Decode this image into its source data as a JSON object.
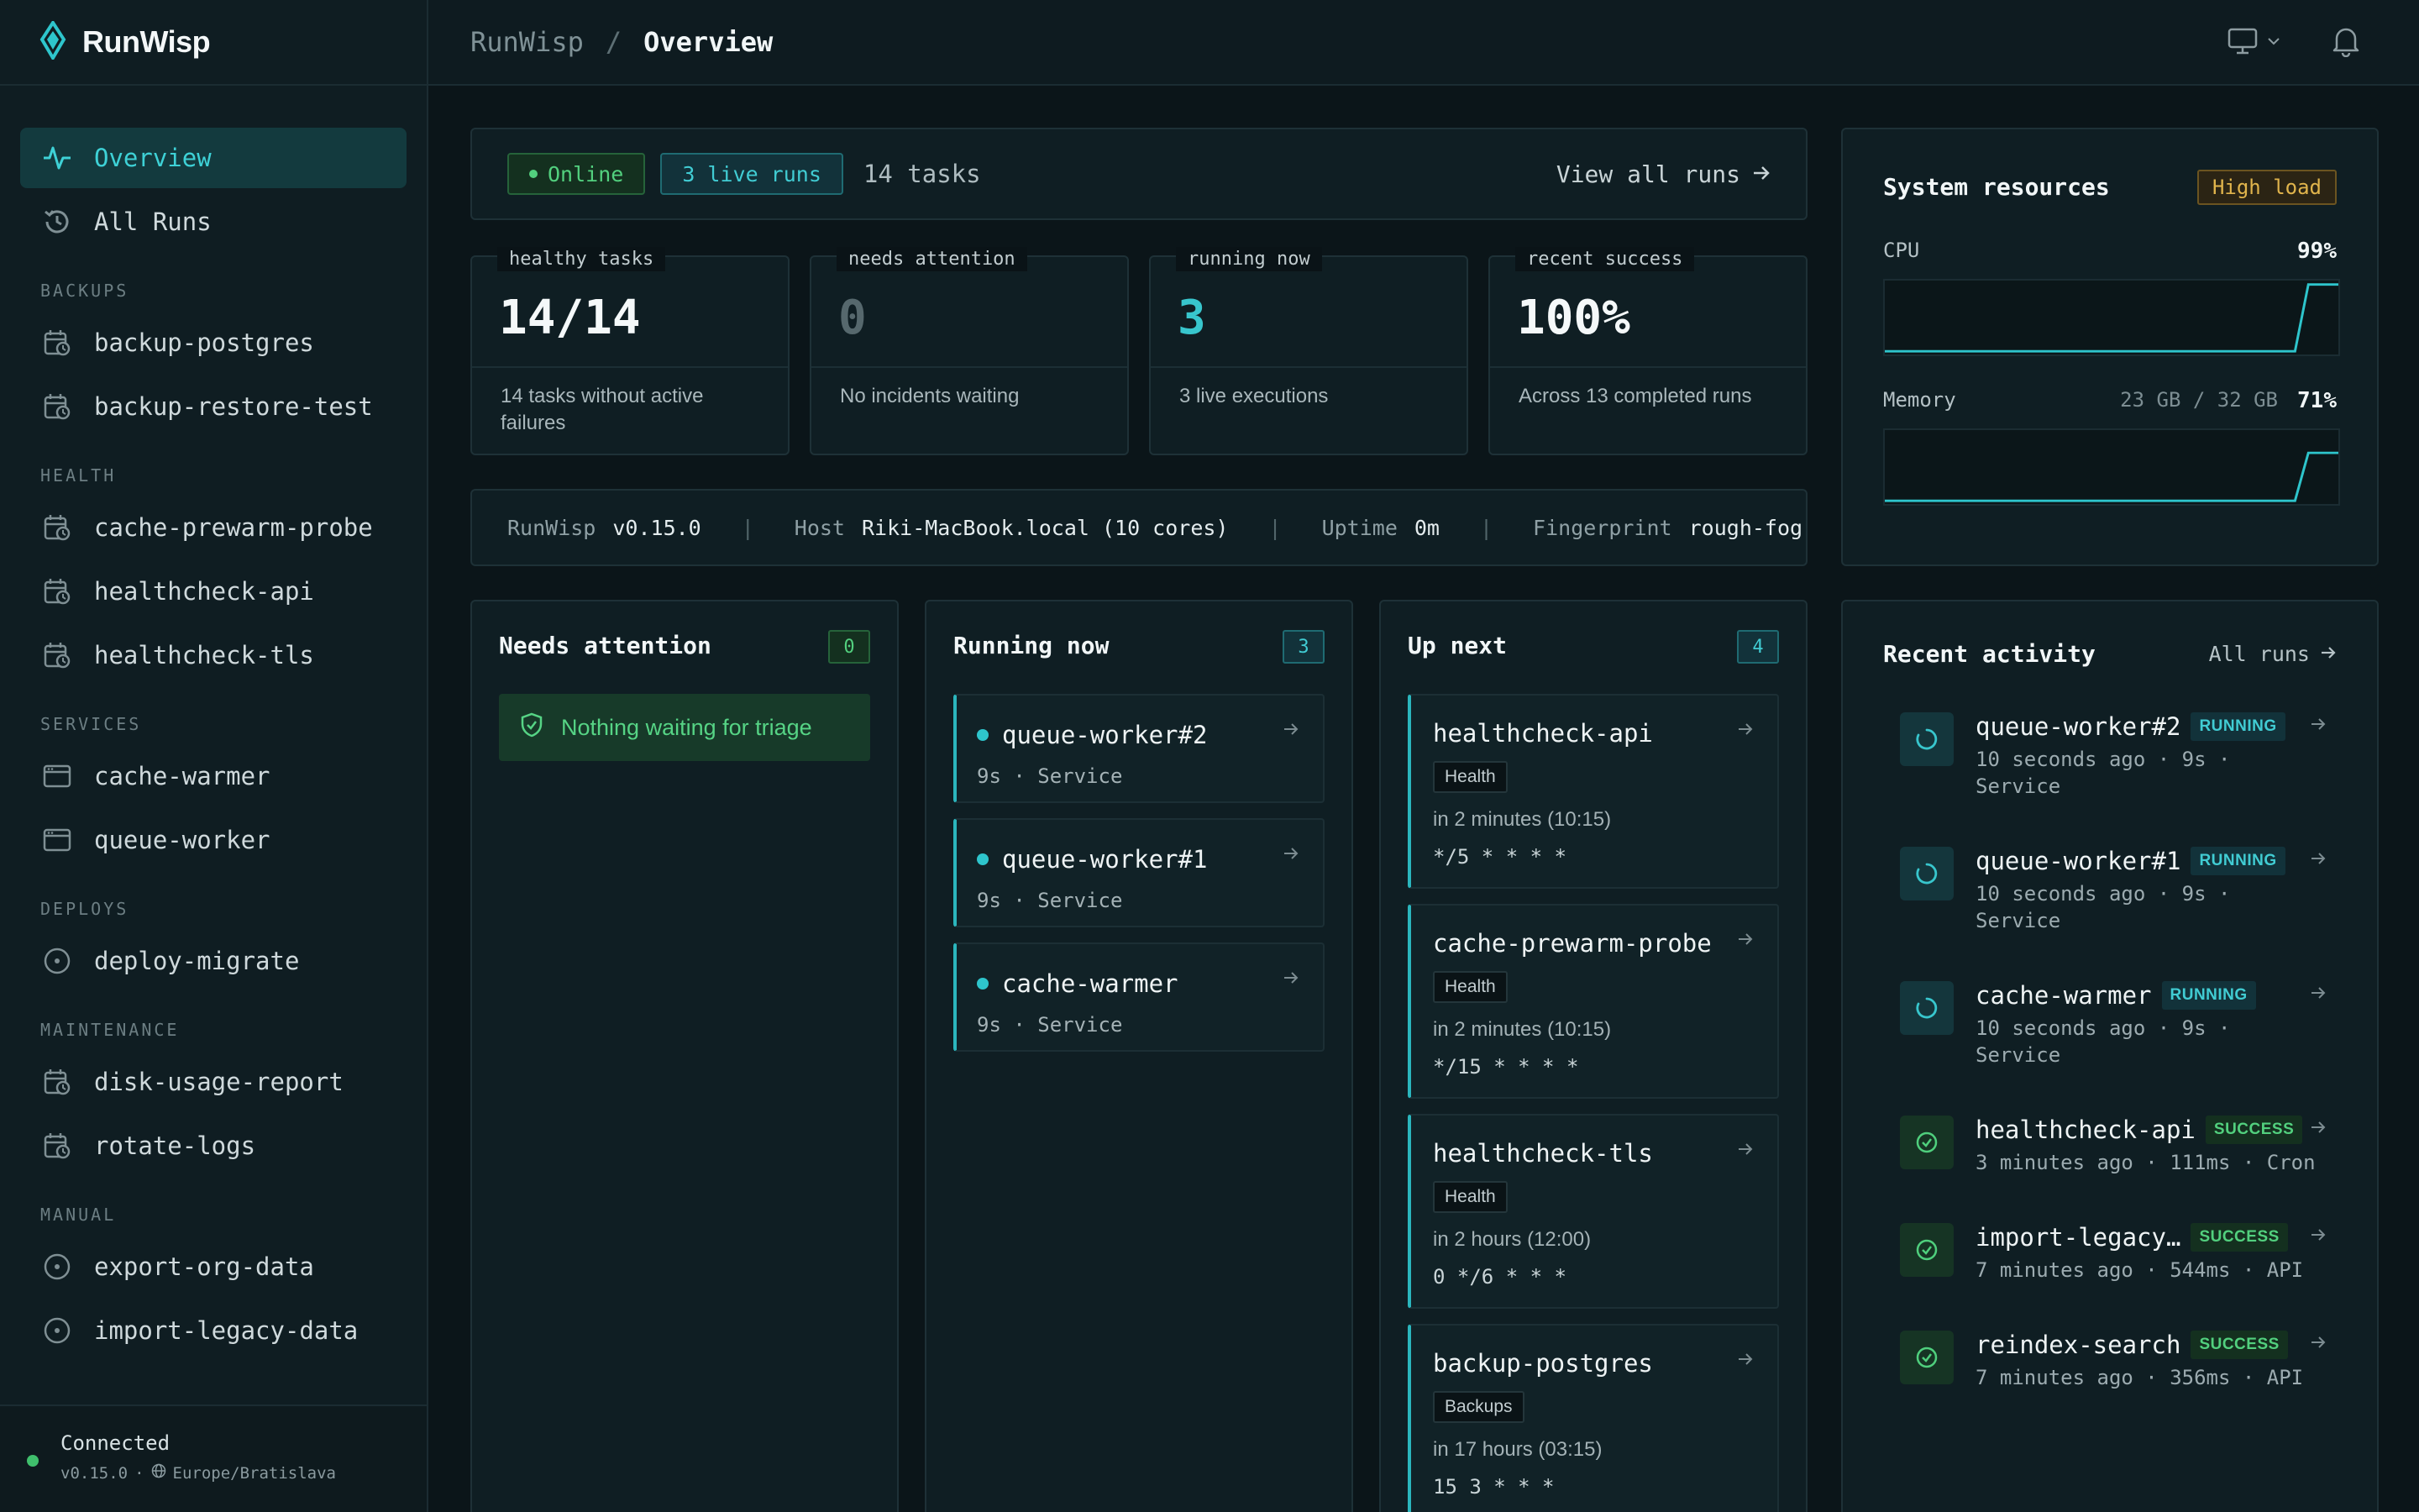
{
  "brand": {
    "name": "RunWisp"
  },
  "sidebar": {
    "primary": [
      {
        "label": "Overview",
        "icon": "activity-icon"
      },
      {
        "label": "All Runs",
        "icon": "history-icon"
      }
    ],
    "sections": [
      {
        "label": "BACKUPS",
        "items": [
          "backup-postgres",
          "backup-restore-test"
        ]
      },
      {
        "label": "HEALTH",
        "items": [
          "cache-prewarm-probe",
          "healthcheck-api",
          "healthcheck-tls"
        ]
      },
      {
        "label": "SERVICES",
        "items": [
          "cache-warmer",
          "queue-worker"
        ]
      },
      {
        "label": "DEPLOYS",
        "items": [
          "deploy-migrate"
        ]
      },
      {
        "label": "MAINTENANCE",
        "items": [
          "disk-usage-report",
          "rotate-logs"
        ]
      },
      {
        "label": "MANUAL",
        "items": [
          "export-org-data",
          "import-legacy-data"
        ]
      }
    ],
    "footer": {
      "status": "Connected",
      "version": "v0.15.0",
      "sep": "·",
      "timezone": "Europe/Bratislava"
    }
  },
  "topbar": {
    "root": "RunWisp",
    "sep": "/",
    "current": "Overview"
  },
  "status_bar": {
    "online": "Online",
    "live_runs": "3 live runs",
    "tasks": "14 tasks",
    "view_all": "View all runs"
  },
  "stats": [
    {
      "label": "healthy tasks",
      "value": "14/14",
      "desc": "14 tasks without active failures",
      "color": "#f4f8f9"
    },
    {
      "label": "needs attention",
      "value": "0",
      "desc": "No incidents waiting",
      "color": "#56686d"
    },
    {
      "label": "running now",
      "value": "3",
      "desc": "3 live executions",
      "color": "#38c6cd"
    },
    {
      "label": "recent success",
      "value": "100%",
      "desc": "Across 13 completed runs",
      "color": "#f4f8f9"
    }
  ],
  "info_bar": {
    "app_key": "RunWisp",
    "app_val": "v0.15.0",
    "host_key": "Host",
    "host_val": "Riki-MacBook.local (10 cores)",
    "uptime_key": "Uptime",
    "uptime_val": "0m",
    "fp_key": "Fingerprint",
    "fp_val": "rough-fog",
    "sep": "|"
  },
  "system": {
    "title": "System resources",
    "badge": "High load",
    "cpu_label": "CPU",
    "cpu_value": "99%",
    "cpu_level": 0.99,
    "mem_label": "Memory",
    "mem_usage": "23 GB / 32 GB",
    "mem_value": "71%",
    "mem_level": 0.71,
    "accent": "#2ec5cc"
  },
  "attention": {
    "title": "Needs attention",
    "count": "0",
    "empty": "Nothing waiting for triage"
  },
  "running": {
    "title": "Running now",
    "count": "3",
    "items": [
      {
        "name": "queue-worker#2",
        "meta": "9s · Service"
      },
      {
        "name": "queue-worker#1",
        "meta": "9s · Service"
      },
      {
        "name": "cache-warmer",
        "meta": "9s · Service"
      }
    ]
  },
  "upnext": {
    "title": "Up next",
    "count": "4",
    "items": [
      {
        "name": "healthcheck-api",
        "tag": "Health",
        "when": "in 2 minutes (10:15)",
        "cron": "*/5 * * * *"
      },
      {
        "name": "cache-prewarm-probe",
        "tag": "Health",
        "when": "in 2 minutes (10:15)",
        "cron": "*/15 * * * *"
      },
      {
        "name": "healthcheck-tls",
        "tag": "Health",
        "when": "in 2 hours (12:00)",
        "cron": "0 */6 * * *"
      },
      {
        "name": "backup-postgres",
        "tag": "Backups",
        "when": "in 17 hours (03:15)",
        "cron": "15 3 * * *"
      }
    ]
  },
  "activity": {
    "title": "Recent activity",
    "all_runs": "All runs",
    "items": [
      {
        "name": "queue-worker#2",
        "status": "RUNNING",
        "meta": "10 seconds ago · 9s · Service"
      },
      {
        "name": "queue-worker#1",
        "status": "RUNNING",
        "meta": "10 seconds ago · 9s · Service"
      },
      {
        "name": "cache-warmer",
        "status": "RUNNING",
        "meta": "10 seconds ago · 9s · Service"
      },
      {
        "name": "healthcheck-api",
        "status": "SUCCESS",
        "meta": "3 minutes ago · 111ms · Cron"
      },
      {
        "name": "import-legacy…",
        "status": "SUCCESS",
        "meta": "7 minutes ago · 544ms · API"
      },
      {
        "name": "reindex-search",
        "status": "SUCCESS",
        "meta": "7 minutes ago · 356ms · API"
      }
    ]
  }
}
